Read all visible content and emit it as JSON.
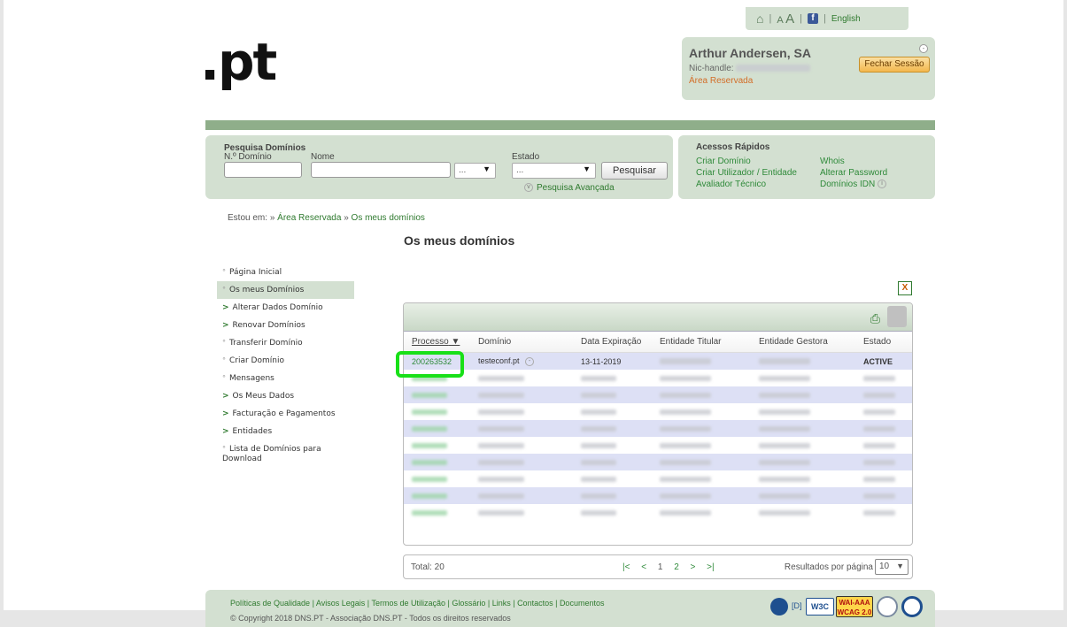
{
  "header": {
    "home_icon": "home-icon",
    "font_size_small": "A",
    "font_size_large": "A",
    "facebook_icon": "facebook-icon",
    "language_link": "English",
    "logo_text": ".pt"
  },
  "user": {
    "name": "Arthur Andersen, SA",
    "handle_label": "Nic-handle:",
    "area_link": "Área Reservada",
    "logout_label": "Fechar Sessão"
  },
  "search": {
    "title": "Pesquisa Domínios",
    "number_label": "N.º Domínio",
    "name_label": "Nome",
    "ext_select_value": "...",
    "state_label": "Estado",
    "state_select_value": "...",
    "search_button": "Pesquisar",
    "advanced_link": "Pesquisa Avançada"
  },
  "quick_access": {
    "title": "Acessos Rápidos",
    "links": [
      "Criar Domínio",
      "Criar Utilizador / Entidade",
      "Avaliador Técnico",
      "Whois",
      "Alterar Password",
      "Domínios IDN"
    ]
  },
  "breadcrumb": {
    "prefix": "Estou em:",
    "sep": "»",
    "items": [
      "Área Reservada",
      "Os meus domínios"
    ]
  },
  "page_title": "Os meus domínios",
  "sidebar": {
    "items": [
      {
        "label": "Página Inicial",
        "marker": "°"
      },
      {
        "label": "Os meus Domínios",
        "marker": "°"
      },
      {
        "label": "Alterar Dados Domínio",
        "marker": ">"
      },
      {
        "label": "Renovar Domínios",
        "marker": ">"
      },
      {
        "label": "Transferir Domínio",
        "marker": "°"
      },
      {
        "label": "Criar Domínio",
        "marker": "°"
      },
      {
        "label": "Mensagens",
        "marker": "°"
      },
      {
        "label": "Os Meus Dados",
        "marker": ">"
      },
      {
        "label": "Facturação e Pagamentos",
        "marker": ">"
      },
      {
        "label": "Entidades",
        "marker": ">"
      },
      {
        "label": "Lista de Domínios para Download",
        "marker": "°"
      }
    ]
  },
  "table": {
    "columns": [
      "Processo",
      "Domínio",
      "Data Expiração",
      "Entidade Titular",
      "Entidade Gestora",
      "Estado"
    ],
    "sort_icon": "sort-down-icon",
    "first_row": {
      "processo": "200263532",
      "dominio": "testeconf.pt",
      "data": "13-11-2019",
      "estado": "ACTIVE"
    },
    "total": "Total: 20",
    "pagination": {
      "first": "|<",
      "prev": "<",
      "pages": [
        "1",
        "2"
      ],
      "next": ">",
      "last": ">|"
    },
    "per_page_label": "Resultados por página",
    "per_page_value": "10"
  },
  "footer": {
    "links": [
      "Políticas de Qualidade",
      "Avisos Legais",
      "Termos de Utilização",
      "Glossário",
      "Links",
      "Contactos",
      "Documentos"
    ],
    "copyright": "© Copyright 2018 DNS.PT - Associação DNS.PT - Todos os direitos reservados",
    "d_label": "[D]",
    "w3c_label": "W3C",
    "wcag_label": "WAI-AAA WCAG 2.0"
  }
}
